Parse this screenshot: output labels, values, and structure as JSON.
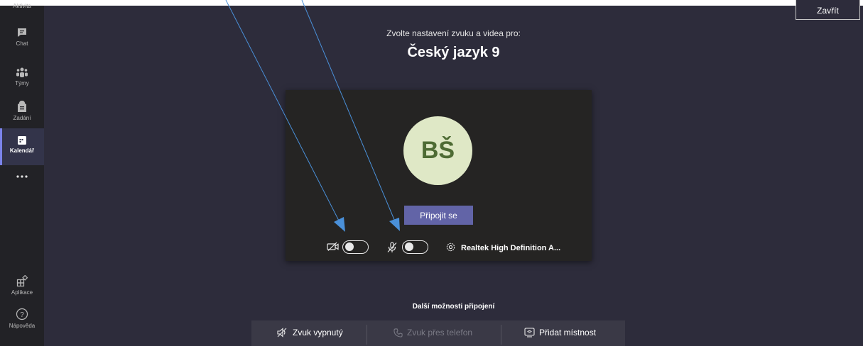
{
  "sidebar": {
    "items": [
      {
        "label": "Aktivita",
        "icon": "bell-icon"
      },
      {
        "label": "Chat",
        "icon": "chat-icon"
      },
      {
        "label": "Týmy",
        "icon": "teams-icon"
      },
      {
        "label": "Zadání",
        "icon": "assignments-icon"
      },
      {
        "label": "Kalendář",
        "icon": "calendar-icon",
        "active": true
      },
      {
        "label": "",
        "icon": "more-icon"
      },
      {
        "label": "Aplikace",
        "icon": "apps-icon"
      },
      {
        "label": "Nápověda",
        "icon": "help-icon"
      }
    ]
  },
  "header": {
    "subtitle": "Zvolte nastavení zvuku a videa pro:",
    "title": "Český jazyk 9",
    "close_label": "Zavřít"
  },
  "preview": {
    "avatar_initials": "BŠ",
    "join_label": "Připojit se",
    "camera_on": false,
    "mic_on": false,
    "device_label": "Realtek High Definition A..."
  },
  "other": {
    "heading": "Další možnosti připojení",
    "options": [
      {
        "label": "Zvuk vypnutý",
        "icon": "speaker-off-icon"
      },
      {
        "label": "Zvuk přes telefon",
        "icon": "phone-icon",
        "disabled": true
      },
      {
        "label": "Přidat místnost",
        "icon": "room-icon"
      }
    ]
  },
  "colors": {
    "sidebar_bg": "#222226",
    "main_bg": "#2d2c3b",
    "accent": "#6264a7",
    "annotation_arrow": "#4a90d9"
  }
}
